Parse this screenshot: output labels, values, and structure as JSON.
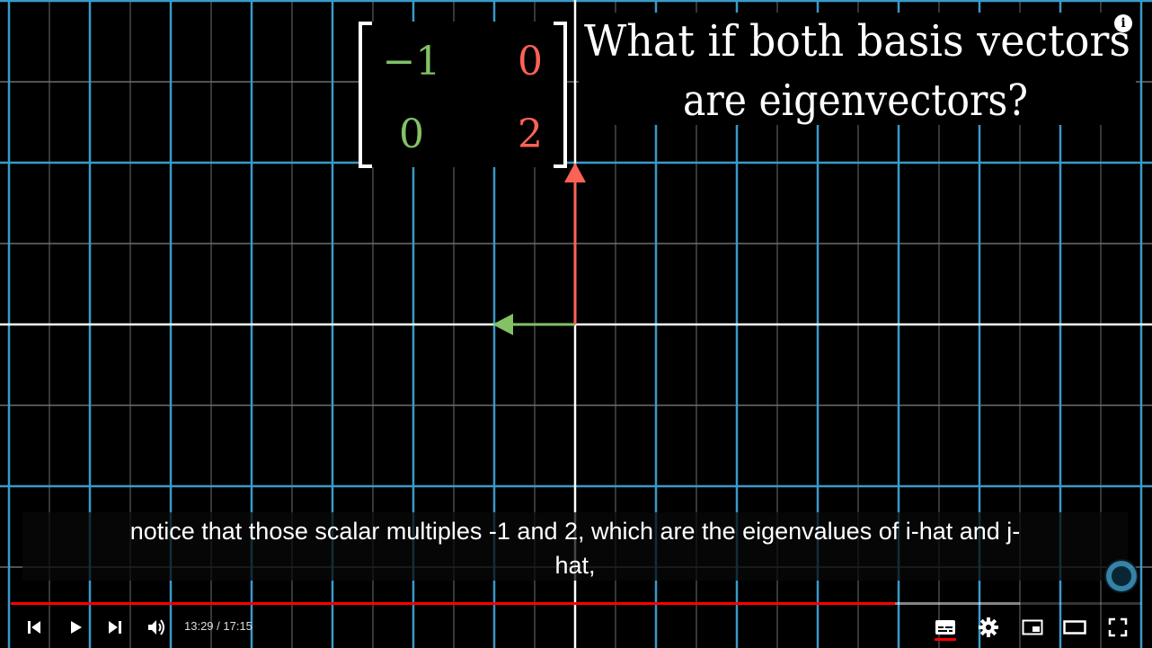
{
  "video": {
    "matrix": {
      "row1": {
        "left": "−1",
        "right": "0"
      },
      "row2": {
        "left": "0",
        "right": "2"
      }
    },
    "title_line1": "What if both basis vectors",
    "title_line2": "are eigenvectors?"
  },
  "caption": {
    "line1": "notice that those scalar multiples -1 and 2, which are the eigenvalues of i-hat and j-",
    "line2": "hat,"
  },
  "player": {
    "info_label": "i",
    "time_display": "13:29 / 17:15",
    "progress_played": 0.782,
    "progress_loaded": 0.893,
    "controls": {
      "prev": "previous-icon",
      "play": "play-icon",
      "next": "next-icon",
      "volume": "volume-icon",
      "subtitles": "subtitles-icon",
      "settings": "gear-icon",
      "miniplayer": "miniplayer-icon",
      "theater": "theater-icon",
      "fullscreen": "fullscreen-icon"
    }
  },
  "colors": {
    "grid_blue": "#3a9ac9",
    "grid_faint": "#6e6e6e",
    "axis_white": "#ffffff",
    "i_hat_green": "#83c167",
    "j_hat_red": "#fc6255",
    "progress_red": "#ff0000"
  }
}
